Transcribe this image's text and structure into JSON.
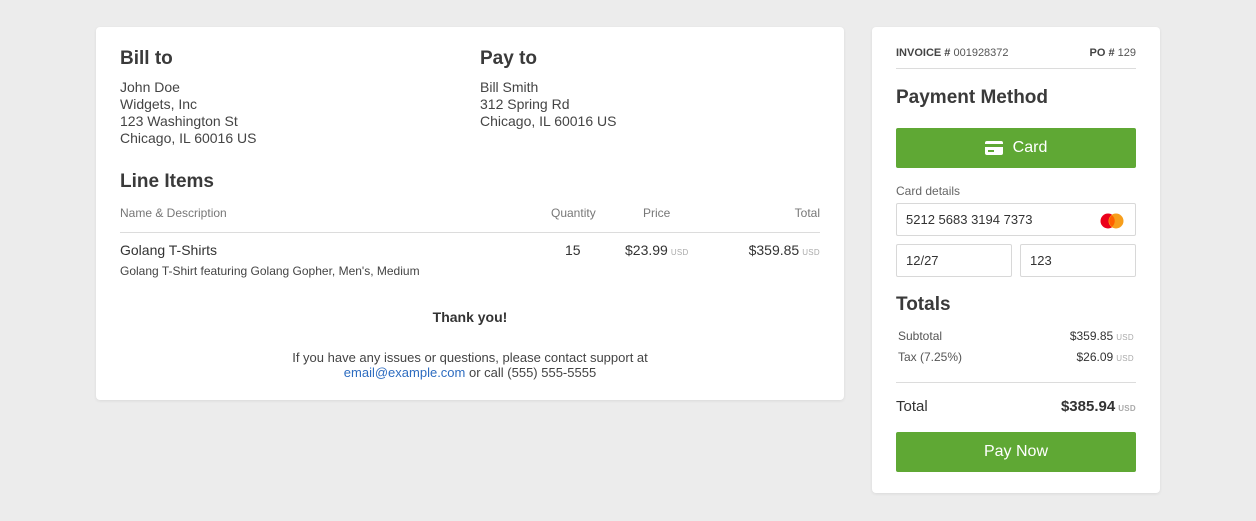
{
  "bill_to": {
    "title": "Bill to",
    "lines": [
      "John Doe",
      "Widgets, Inc",
      "123 Washington St",
      "Chicago, IL 60016 US"
    ]
  },
  "pay_to": {
    "title": "Pay to",
    "lines": [
      "Bill Smith",
      "312 Spring Rd",
      "Chicago, IL 60016 US"
    ]
  },
  "line_items": {
    "title": "Line Items",
    "headers": {
      "name": "Name & Description",
      "quantity": "Quantity",
      "price": "Price",
      "total": "Total"
    },
    "rows": [
      {
        "name": "Golang T-Shirts",
        "description": "Golang T-Shirt featuring Golang Gopher, Men's, Medium",
        "quantity": "15",
        "price": "$23.99",
        "total": "$359.85",
        "currency": "USD"
      }
    ]
  },
  "thanks": "Thank you!",
  "support": {
    "text_before": "If you have any issues or questions, please contact support at",
    "email": "email@example.com",
    "text_after": " or call (555) 555-5555"
  },
  "invoice": {
    "invoice_label": "INVOICE #",
    "invoice_number": "001928372",
    "po_label": "PO #",
    "po_number": "129"
  },
  "payment": {
    "title": "Payment Method",
    "card_button": "Card",
    "card_details_label": "Card details",
    "card_number": "5212 5683 3194 7373",
    "card_brand_icon": "mastercard-icon",
    "expiry": "12/27",
    "cvc": "123",
    "pay_button": "Pay Now"
  },
  "totals": {
    "title": "Totals",
    "subtotal_label": "Subtotal",
    "subtotal": "$359.85",
    "tax_label": "Tax (7.25%)",
    "tax": "$26.09",
    "total_label": "Total",
    "total": "$385.94",
    "currency": "USD"
  },
  "colors": {
    "accent": "#5fa834",
    "link": "#2d6cc0",
    "background": "#ececec"
  }
}
